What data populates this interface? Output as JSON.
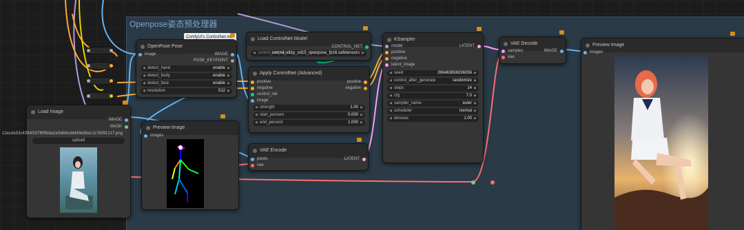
{
  "group": {
    "title": "Openpose姿态预处理器"
  },
  "tooltip": "ComfyUI's ControlNet Au..",
  "load_image": {
    "title": "Load Image",
    "out_image": "IMAGE",
    "out_mask": "MASK",
    "filename": "12ecde53c4394f167f6f5b8a2e5db9cddd49dd5dc1178091217.png",
    "upload": "upload"
  },
  "openpose": {
    "title": "OpenPose Pose",
    "in_image": "image",
    "out_image": "IMAGE",
    "out_keypoint": "POSE_KEYPOINT",
    "widgets": [
      {
        "name": "detect_hand",
        "value": "enable"
      },
      {
        "name": "detect_body",
        "value": "enable"
      },
      {
        "name": "detect_face",
        "value": "enable"
      },
      {
        "name": "resolution",
        "value": "512"
      }
    ]
  },
  "preview_small": {
    "title": "Preview Image",
    "in_images": "images"
  },
  "load_controlnet": {
    "title": "Load ControlNet Model",
    "out": "CONTROL_NET",
    "widget_name": "control_net_name",
    "widget_value": "control_v11p_sd15_openpose_fp16.safetensors"
  },
  "apply_controlnet": {
    "title": "Apply ControlNet (Advanced)",
    "inputs": [
      "positive",
      "negative",
      "control_net",
      "image"
    ],
    "outputs": [
      "positive",
      "negative"
    ],
    "widgets": [
      {
        "name": "strength",
        "value": "1.00"
      },
      {
        "name": "start_percent",
        "value": "0.000"
      },
      {
        "name": "end_percent",
        "value": "1.000"
      }
    ]
  },
  "vae_encode": {
    "title": "VAE Encode",
    "inputs": [
      "pixels",
      "vae"
    ],
    "out": "LATENT"
  },
  "ksampler": {
    "title": "KSampler",
    "inputs": [
      "model",
      "positive",
      "negative",
      "latent_image"
    ],
    "out": "LATENT",
    "widgets": [
      {
        "name": "seed",
        "value": "266483656036056"
      },
      {
        "name": "control_after_generate",
        "value": "randomize"
      },
      {
        "name": "steps",
        "value": "14"
      },
      {
        "name": "cfg",
        "value": "7.0"
      },
      {
        "name": "sampler_name",
        "value": "euler"
      },
      {
        "name": "scheduler",
        "value": "normal"
      },
      {
        "name": "denoise",
        "value": "1.00"
      }
    ]
  },
  "vae_decode": {
    "title": "VAE Decode",
    "inputs": [
      "samples",
      "vae"
    ],
    "out": "IMAGE"
  },
  "preview_large": {
    "title": "Preview Image",
    "in_images": "images"
  },
  "colors": {
    "image": "#64b5f6",
    "model": "#b39ddb",
    "conditioning": "#ffa931",
    "latent": "#ff9cf9",
    "vae": "#ff6e6e",
    "control_net": "#00d78d",
    "mask": "#81c784",
    "keypoint": "#a0a0a0"
  }
}
